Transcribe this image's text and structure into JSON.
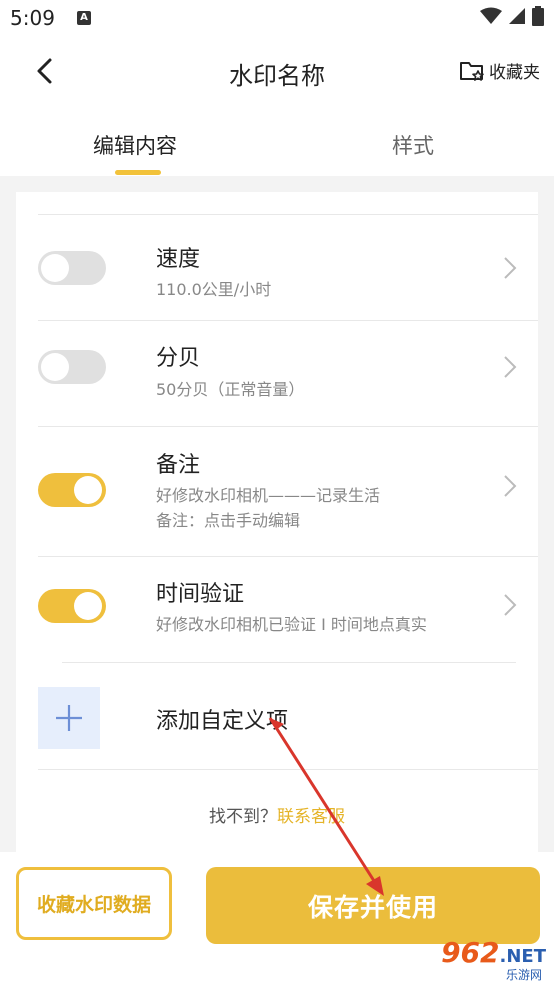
{
  "status": {
    "time": "5:09",
    "notif": "A"
  },
  "header": {
    "title": "水印名称",
    "fav_label": "收藏夹"
  },
  "tabs": [
    {
      "label": "编辑内容"
    },
    {
      "label": "样式"
    }
  ],
  "rows": [
    {
      "title": "速度",
      "subtitle": "110.0公里/小时",
      "enabled": false
    },
    {
      "title": "分贝",
      "subtitle": "50分贝（正常音量）",
      "enabled": false
    },
    {
      "title": "备注",
      "subtitle": "好修改水印相机———记录生活",
      "subtitle2": "备注：点击手动编辑",
      "enabled": true
    },
    {
      "title": "时间验证",
      "subtitle": "好修改水印相机已验证 I 时间地点真实",
      "enabled": true
    }
  ],
  "add_custom": {
    "label": "添加自定义项"
  },
  "help": {
    "prefix": "找不到？",
    "link": "联系客服"
  },
  "bottom": {
    "collect_label": "收藏水印数据",
    "save_label": "保存并使用"
  },
  "watermark": {
    "brand": "962",
    "net": ".NET",
    "sub": "乐游网"
  },
  "colors": {
    "accent": "#efbf3d",
    "link": "#e5b429",
    "toggle_off": "#e0e0e0",
    "add_box": "#e6eefc",
    "annotation_arrow": "#d9362c"
  }
}
